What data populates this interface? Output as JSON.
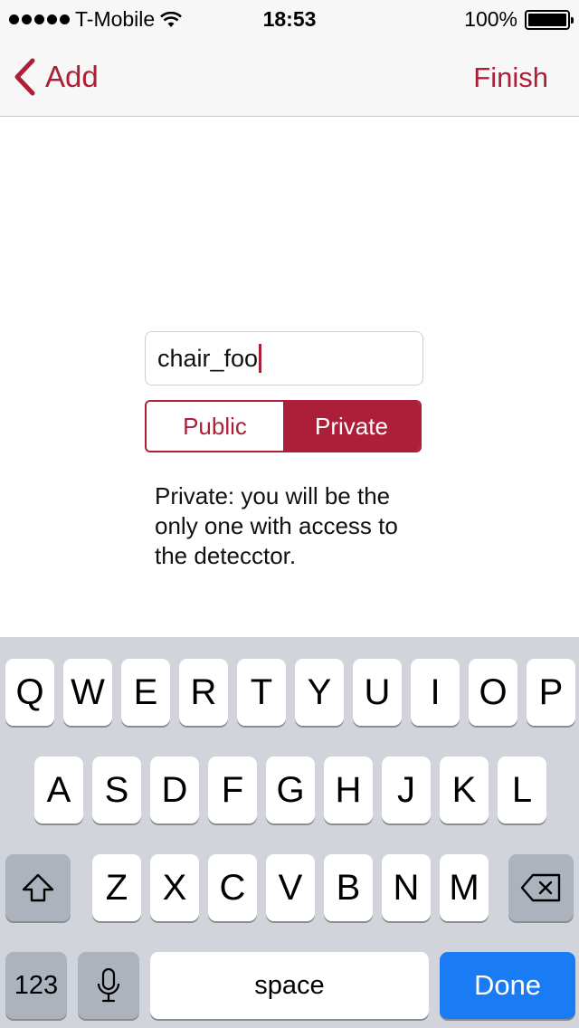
{
  "status_bar": {
    "carrier": "T-Mobile",
    "time": "18:53",
    "battery": "100%",
    "battery_level": 1.0
  },
  "nav": {
    "back_label": "Add",
    "action_label": "Finish"
  },
  "name_field": {
    "value": "chair_foo"
  },
  "visibility": {
    "options": [
      "Public",
      "Private"
    ],
    "selected": "Private"
  },
  "description": "Private: you will be the only one with access to the detecctor.",
  "keyboard": {
    "row1": [
      "Q",
      "W",
      "E",
      "R",
      "T",
      "Y",
      "U",
      "I",
      "O",
      "P"
    ],
    "row2": [
      "A",
      "S",
      "D",
      "F",
      "G",
      "H",
      "J",
      "K",
      "L"
    ],
    "row3": [
      "Z",
      "X",
      "C",
      "V",
      "B",
      "N",
      "M"
    ],
    "numbers_label": "123",
    "space_label": "space",
    "done_label": "Done"
  },
  "colors": {
    "accent": "#ad1f38",
    "done_button": "#1a7cf5",
    "keyboard_bg": "#d1d5db"
  }
}
